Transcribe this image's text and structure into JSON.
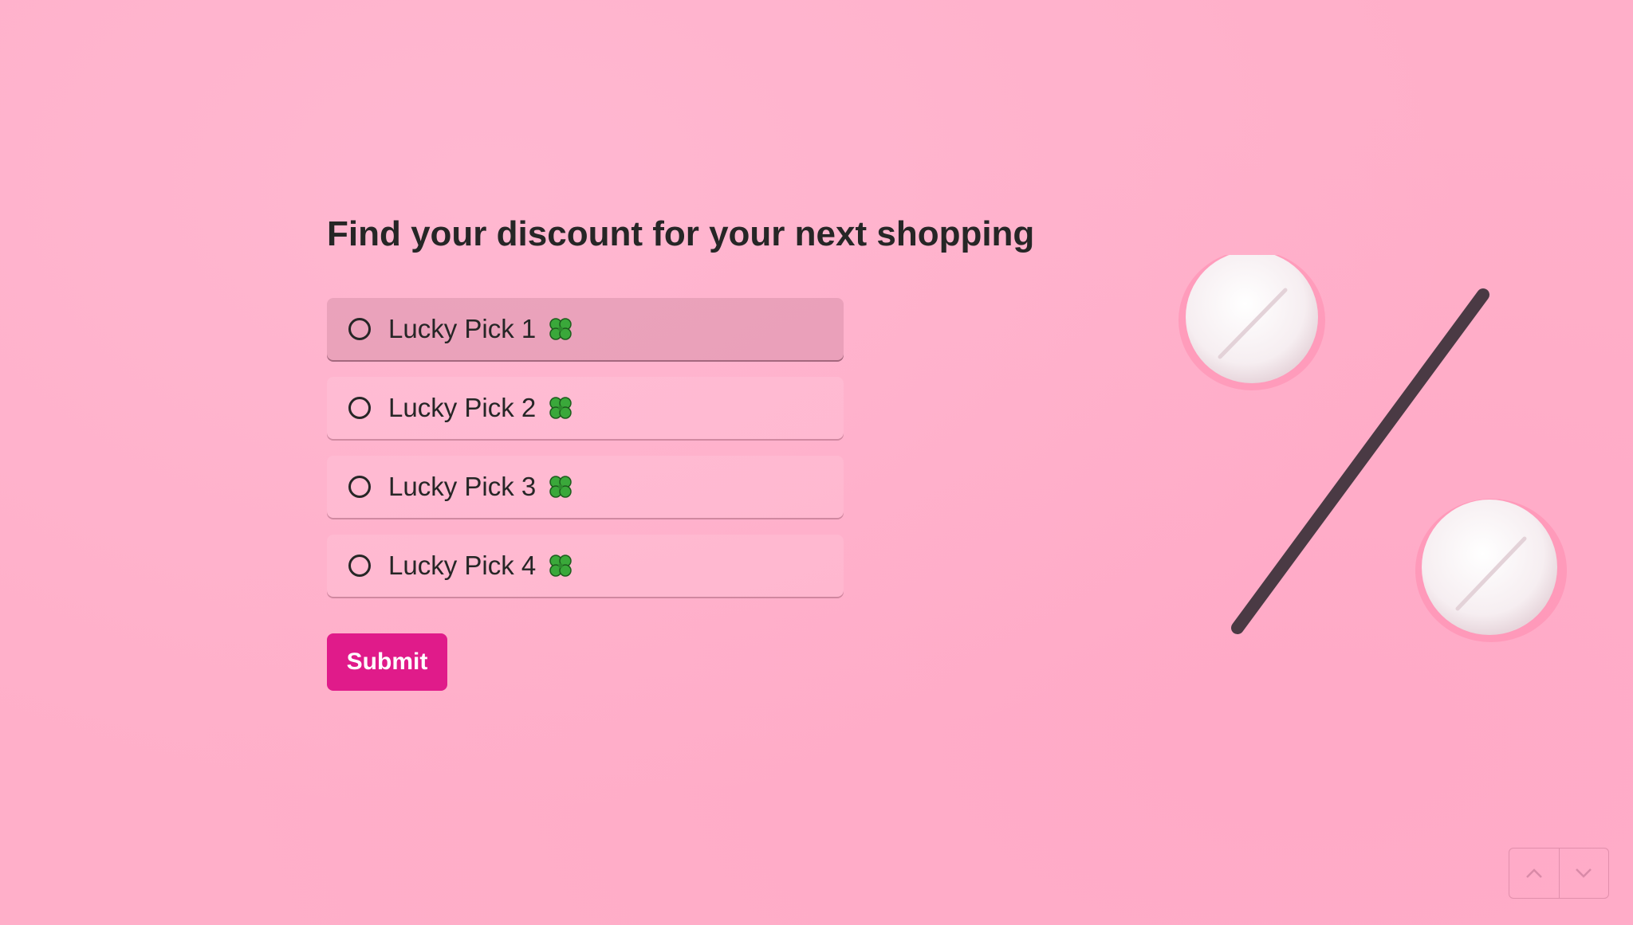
{
  "form": {
    "title": "Find your discount for your next shopping",
    "options": [
      {
        "label": "Lucky Pick 1",
        "selected": false,
        "hovered": true
      },
      {
        "label": "Lucky Pick 2",
        "selected": false
      },
      {
        "label": "Lucky Pick 3",
        "selected": false
      },
      {
        "label": "Lucky Pick 4",
        "selected": false
      }
    ],
    "submit_label": "Submit"
  },
  "icons": {
    "title_icon": "shopping-bags-icon",
    "option_icon": "four-leaf-clover-icon",
    "nav_up": "chevron-up-icon",
    "nav_down": "chevron-down-icon"
  },
  "colors": {
    "background": "#ffafc9",
    "accent": "#e01b8a",
    "text": "#262626"
  }
}
